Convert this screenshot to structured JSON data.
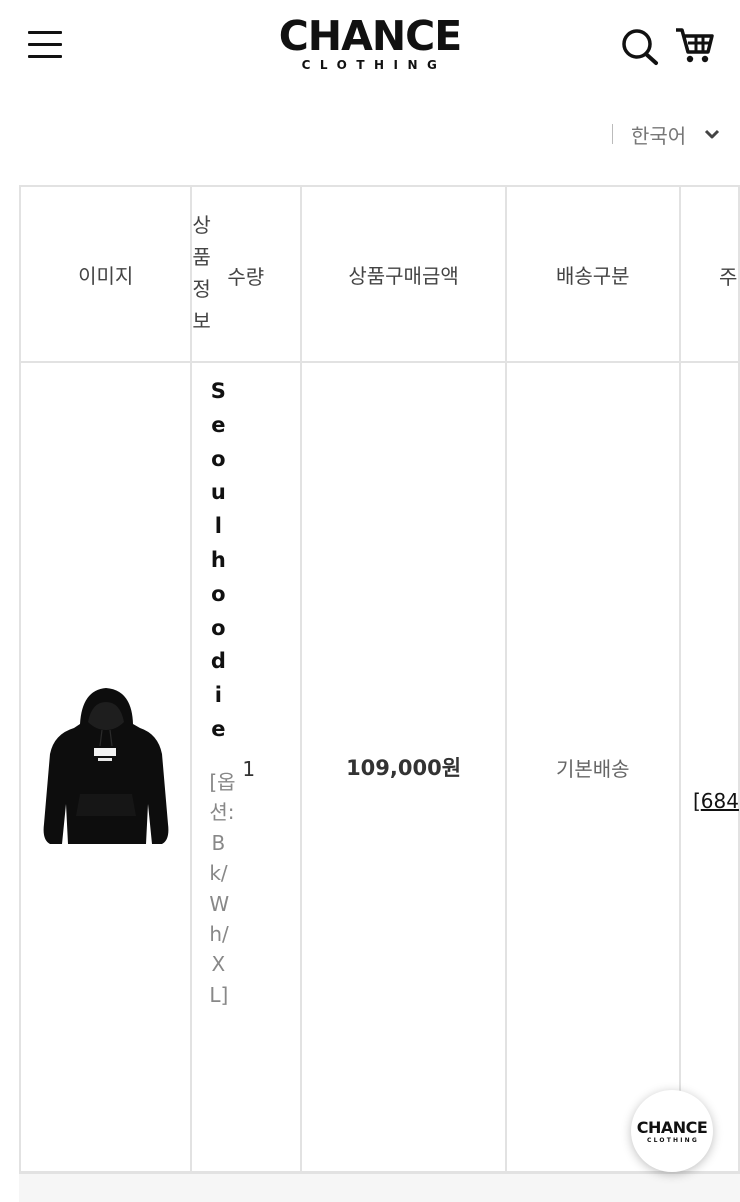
{
  "header": {
    "logo_main": "CHANCE",
    "logo_sub": "CLOTHING"
  },
  "language": {
    "selected": "한국어"
  },
  "table": {
    "headers": {
      "image": "이미지",
      "product_info": "상품정보",
      "quantity": "수량",
      "price": "상품구매금액",
      "shipping": "배송구분",
      "extra": "주"
    },
    "row": {
      "product_name": "Seoulhoodie",
      "option": "[옵션: Bk/Wh/XL]",
      "quantity": "1",
      "price": "109,000원",
      "shipping": "기본배송",
      "addr_bracket": "[",
      "addr_code": "684"
    }
  },
  "fab": {
    "logo_main": "CHANCE",
    "logo_sub": "CLOTHING"
  },
  "colors": {
    "text": "#222222",
    "border": "#e2e2e2",
    "muted": "#888888"
  }
}
